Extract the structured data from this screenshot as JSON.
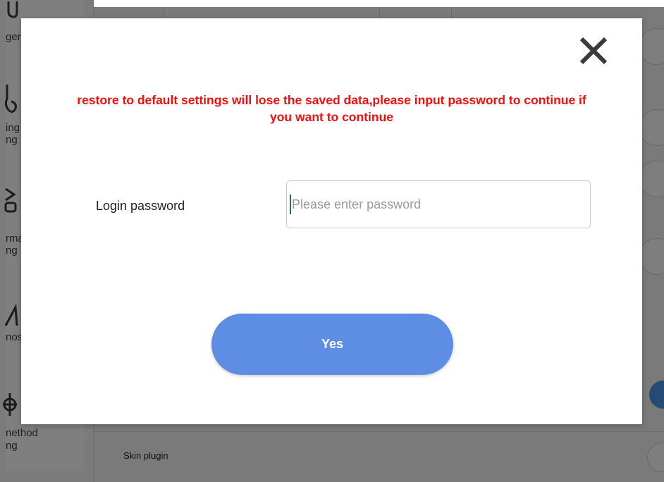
{
  "background": {
    "sidebar_items": [
      {
        "label": "ger",
        "icon": "power-icon"
      },
      {
        "label_line1": "ing",
        "label_line2": "ng",
        "icon": "hand-icon"
      },
      {
        "label_line1": "rma",
        "label_line2": "ng",
        "icon": "info-icon"
      },
      {
        "label": "nos",
        "icon": "warning-icon"
      },
      {
        "label_line1": "nethod",
        "label_line2": "ng",
        "icon": "input-method-icon"
      }
    ],
    "main": {
      "skin_plugin_label": "Skin plugin"
    }
  },
  "dialog": {
    "close_icon": "close-icon",
    "warning_text_line1": "restore to default settings will lose the saved data,please input password to continue if",
    "warning_text_line2": "you want to continue",
    "password_label": "Login password",
    "password_placeholder": "Please enter password",
    "password_value": "",
    "yes_label": "Yes"
  },
  "colors": {
    "warning": "#ee1111",
    "button": "#5d8ee4",
    "overlay": "#7d7d7d",
    "toggle_on": "#254a76"
  }
}
